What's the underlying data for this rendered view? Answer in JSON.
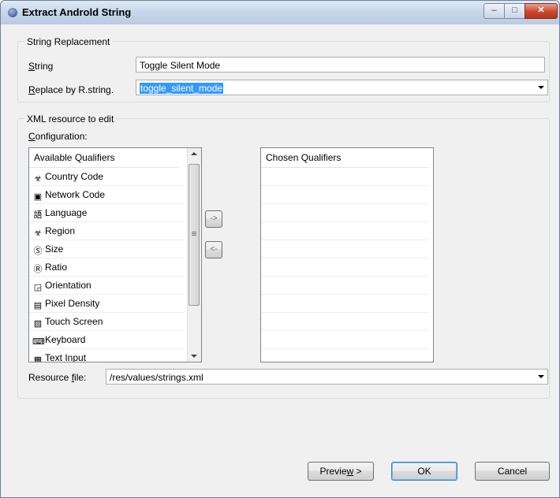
{
  "window": {
    "title": "Extract Androld String"
  },
  "string_replacement": {
    "legend": "String Replacement",
    "string_label_mnemonic": "S",
    "string_label_rest": "tring",
    "string_value": "Toggle  Silent Mode",
    "replace_label_mnemonic": "R",
    "replace_label_rest": "eplace by R.string.",
    "replace_value": "toggle_silent_mode"
  },
  "xml_resource": {
    "legend": "XML resource to edit",
    "config_label_mnemonic": "C",
    "config_label_rest": "onfiguration:",
    "available_header": "Available Qualifiers",
    "available_items": [
      {
        "label": "Country Code",
        "icon": "country-code-icon"
      },
      {
        "label": "Network Code",
        "icon": "network-code-icon"
      },
      {
        "label": "Language",
        "icon": "language-icon"
      },
      {
        "label": "Region",
        "icon": "region-icon"
      },
      {
        "label": "Size",
        "icon": "size-icon"
      },
      {
        "label": "Ratio",
        "icon": "ratio-icon"
      },
      {
        "label": "Orientation",
        "icon": "orientation-icon"
      },
      {
        "label": "Pixel Density",
        "icon": "pixel-density-icon"
      },
      {
        "label": "Touch Screen",
        "icon": "touch-screen-icon"
      },
      {
        "label": "Keyboard",
        "icon": "keyboard-icon"
      },
      {
        "label": "Text Input",
        "icon": "text-input-icon"
      }
    ],
    "add_button": "->",
    "remove_button": "<-",
    "chosen_header": "Chosen Qualifiers",
    "resource_label_pre": "Resource ",
    "resource_label_mnemonic": "f",
    "resource_label_post": "ile:",
    "resource_value": "/res/values/strings.xml"
  },
  "buttons": {
    "preview_pre": "Previe",
    "preview_mnemonic": "w",
    "preview_post": " >",
    "ok": "OK",
    "cancel": "Cancel"
  }
}
